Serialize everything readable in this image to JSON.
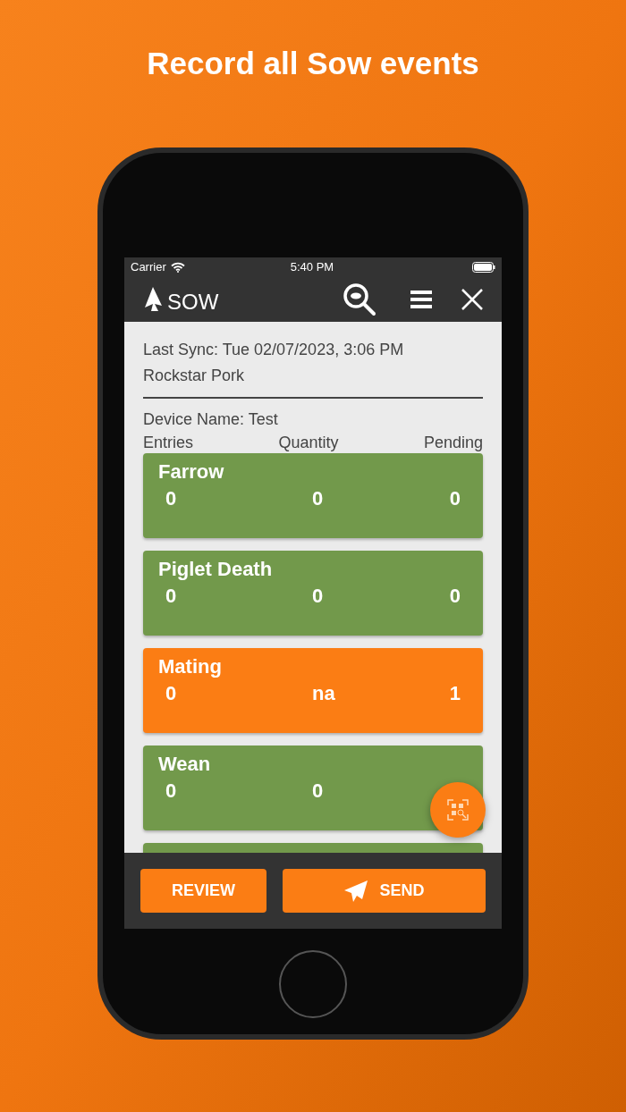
{
  "headline": "Record all Sow events",
  "status_bar": {
    "carrier": "Carrier",
    "time": "5:40 PM"
  },
  "app_bar": {
    "logo_text": "SOW"
  },
  "sync": {
    "last_sync": "Last Sync: Tue 02/07/2023, 3:06 PM",
    "farm": "Rockstar Pork"
  },
  "device": "Device Name: Test",
  "columns": [
    "Entries",
    "Quantity",
    "Pending"
  ],
  "cards": [
    {
      "title": "Farrow",
      "entries": "0",
      "quantity": "0",
      "pending": "0",
      "color": "#72994b"
    },
    {
      "title": "Piglet Death",
      "entries": "0",
      "quantity": "0",
      "pending": "0",
      "color": "#72994b"
    },
    {
      "title": "Mating",
      "entries": "0",
      "quantity": "na",
      "pending": "1",
      "color": "#fb7d14"
    },
    {
      "title": "Wean",
      "entries": "0",
      "quantity": "0",
      "color": "#72994b"
    },
    {
      "color": "#72994b"
    }
  ],
  "buttons": {
    "review": "REVIEW",
    "send": "SEND"
  }
}
